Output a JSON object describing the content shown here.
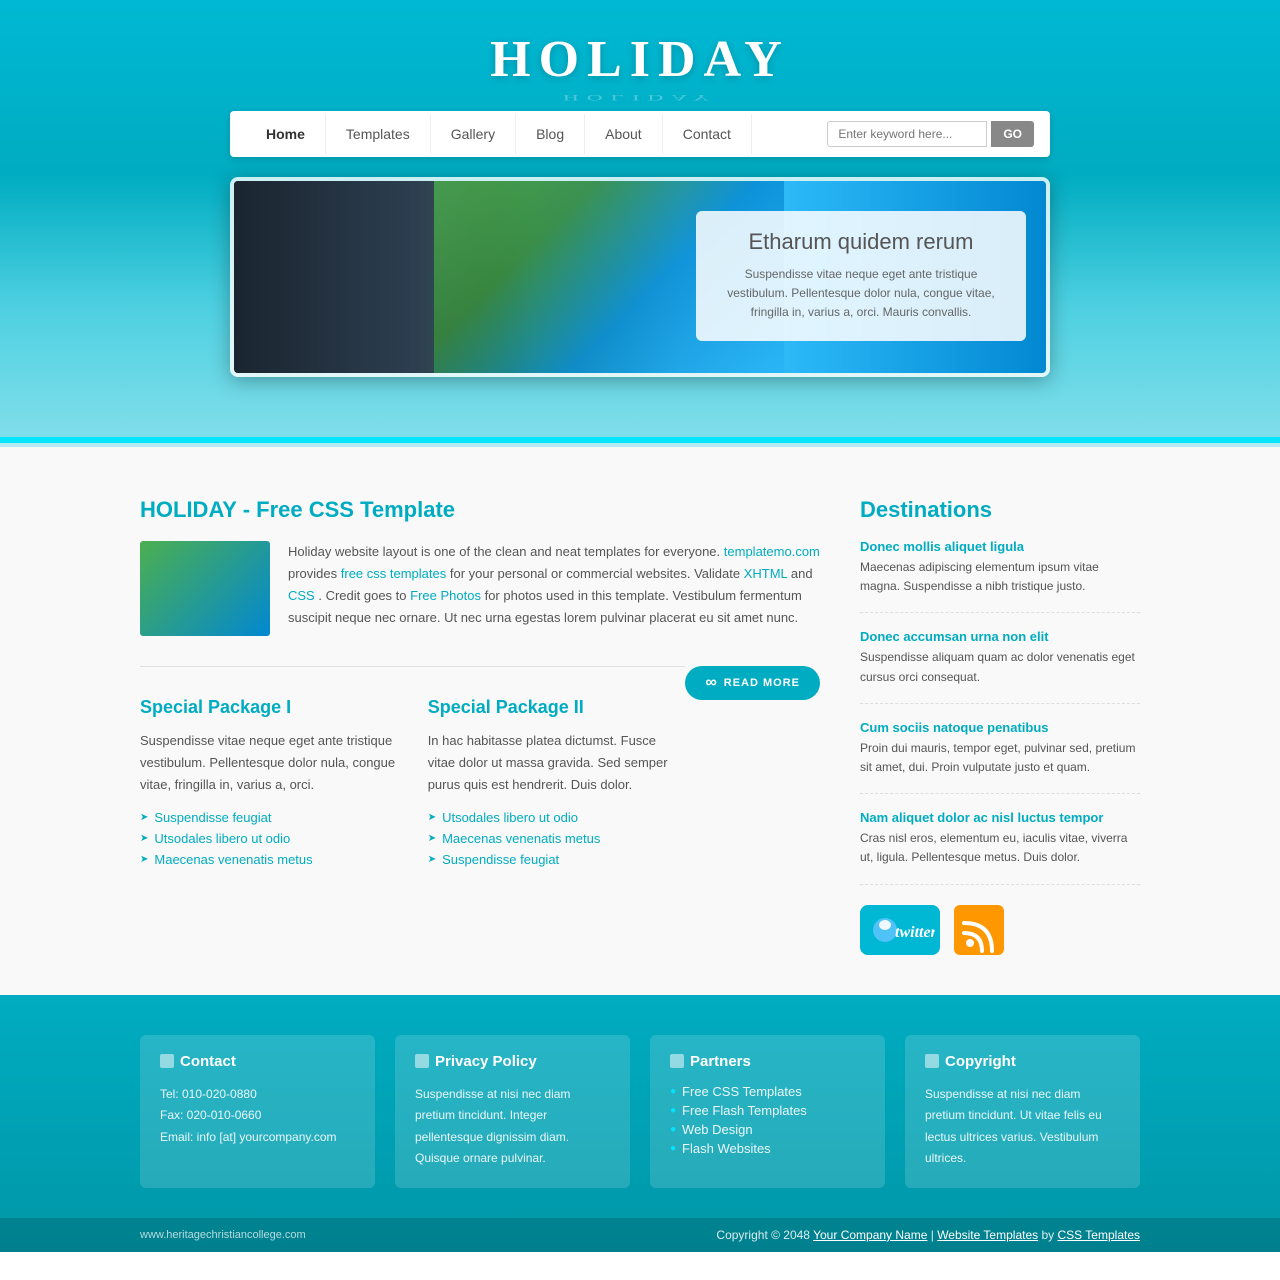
{
  "site": {
    "title": "HOLIDAY",
    "url": "www.heritagechristiancollege.com"
  },
  "nav": {
    "links": [
      {
        "label": "Home",
        "active": true
      },
      {
        "label": "Templates",
        "active": false
      },
      {
        "label": "Gallery",
        "active": false
      },
      {
        "label": "Blog",
        "active": false
      },
      {
        "label": "About",
        "active": false
      },
      {
        "label": "Contact",
        "active": false
      }
    ],
    "search_placeholder": "Enter keyword here...",
    "search_button": "GO"
  },
  "hero": {
    "title": "Etharum quidem rerum",
    "description": "Suspendisse vitae neque eget ante tristique vestibulum. Pellentesque dolor nula, congue vitae, fringilla in, varius a, orci. Mauris convallis."
  },
  "main": {
    "section_title": "HOLIDAY - Free CSS Template",
    "about_text_1": "Holiday website layout is one of the clean and neat templates for everyone.",
    "about_link1": "templatemo.com",
    "about_text_2": " provides ",
    "about_link2": "free css templates",
    "about_text_3": " for your personal or commercial websites. Validate ",
    "about_link3": "XHTML",
    "about_text_4": " and ",
    "about_link4": "CSS",
    "about_text_5": ". Credit goes to ",
    "about_link5": "Free Photos",
    "about_text_6": " for photos used in this template. Vestibulum fermentum suscipit neque nec ornare. Ut nec urna egestas lorem pulvinar placerat eu sit amet nunc.",
    "read_more": "READ MORE",
    "packages": [
      {
        "title": "Special Package I",
        "description": "Suspendisse vitae neque eget ante tristique vestibulum. Pellentesque dolor nula, congue vitae, fringilla in, varius a, orci.",
        "items": [
          "Suspendisse feugiat",
          "Utsodales libero ut odio",
          "Maecenas venenatis metus"
        ]
      },
      {
        "title": "Special Package II",
        "description": "In hac habitasse platea dictumst. Fusce vitae dolor ut massa gravida. Sed semper purus quis est hendrerit. Duis dolor.",
        "items": [
          "Utsodales libero ut odio",
          "Maecenas venenatis metus",
          "Suspendisse feugiat"
        ]
      }
    ]
  },
  "sidebar": {
    "title": "Destinations",
    "items": [
      {
        "link": "Donec mollis aliquet ligula",
        "desc": "Maecenas adipiscing elementum ipsum vitae magna. Suspendisse a nibh tristique justo."
      },
      {
        "link": "Donec accumsan urna non elit",
        "desc": "Suspendisse aliquam quam ac dolor venenatis eget cursus orci consequat."
      },
      {
        "link": "Cum sociis natoque penatibus",
        "desc": "Proin dui mauris, tempor eget, pulvinar sed, pretium sit amet, dui. Proin vulputate justo et quam."
      },
      {
        "link": "Nam aliquet dolor ac nisl luctus tempor",
        "desc": "Cras nisl eros, elementum eu, iaculis vitae, viverra ut, ligula. Pellentesque metus. Duis dolor."
      }
    ],
    "social": {
      "twitter": "twitter",
      "rss": "rss"
    }
  },
  "footer": {
    "columns": [
      {
        "title": "Contact",
        "content": "Tel: 010-020-0880\nFax: 020-010-0660\nEmail: info [at] yourcompany.com"
      },
      {
        "title": "Privacy Policy",
        "content": "Suspendisse at nisi nec diam pretium tincidunt. Integer pellentesque dignissim diam. Quisque ornare pulvinar."
      },
      {
        "title": "Partners",
        "links": [
          "Free CSS Templates",
          "Free Flash Templates",
          "Web Design",
          "Flash Websites"
        ]
      },
      {
        "title": "Copyright",
        "content": "Suspendisse at nisi nec diam pretium tincidunt. Ut vitae felis eu lectus ultrices varius. Vestibulum ultrices."
      }
    ],
    "copyright_text": "Copyright © 2048",
    "company_link": "Your Company Name",
    "separator": "|",
    "templates_link": "Website Templates",
    "by_text": "by",
    "css_link": "CSS Templates"
  }
}
